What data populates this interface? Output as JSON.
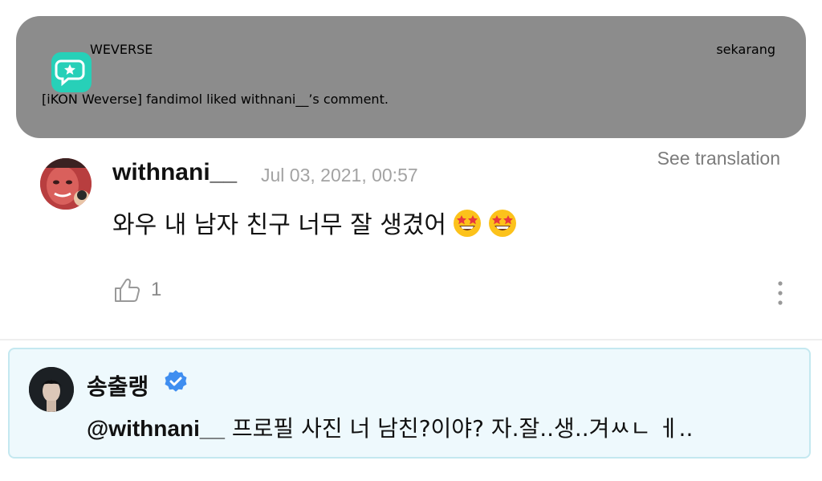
{
  "notification": {
    "app_name": "WEVERSE",
    "time": "sekarang",
    "message": "[iKON Weverse] fandimol liked withnani__’s comment.",
    "icon": "weverse-app-icon",
    "icon_color": "#27d0b8",
    "background": "#8c8c8c"
  },
  "comment": {
    "see_translation": "See translation",
    "username": "withnani__",
    "timestamp": "Jul 03, 2021, 00:57",
    "text": "와우 내 남자 친구 너무 잘 생겼어",
    "emojis": [
      "star-struck-emoji",
      "star-struck-emoji"
    ],
    "like_count": "1",
    "like_icon": "thumbs-up-icon",
    "more_icon": "more-vertical-icon"
  },
  "reply": {
    "username": "송출랭",
    "verified_icon": "verified-badge-icon",
    "mention": "@withnani__",
    "text": "프로필 사진 너 남친?이야? 자.잘..생..겨ㅆㄴ ㅔ..",
    "background": "#eef9fd",
    "border": "#c4e8f0"
  }
}
